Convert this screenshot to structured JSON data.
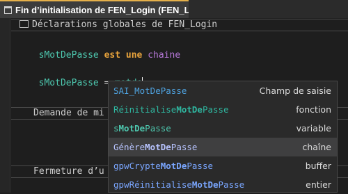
{
  "tab": {
    "title": "Fin d’initialisation de FEN_Login (FEN_Lo..."
  },
  "sections": {
    "declarations": "Déclarations globales de FEN_Login",
    "demande": "Demande de mi",
    "fermeture": "Fermeture d’u"
  },
  "code": {
    "line1": {
      "var": "sMotDePasse",
      "kw": "est une",
      "type": "chaine"
    },
    "line2": {
      "var": "sMotDePasse",
      "op": " = ",
      "typed": "motde"
    }
  },
  "autocomplete": {
    "items": [
      {
        "parts": [
          {
            "t": "SAI_",
            "m": false
          },
          {
            "t": "MotDePasse",
            "m": false
          }
        ],
        "type": "Champ de saisie",
        "color": "#4fa3e0",
        "selected": false
      },
      {
        "parts": [
          {
            "t": "Réinitialise",
            "m": false
          },
          {
            "t": "MotDe",
            "m": true
          },
          {
            "t": "Passe",
            "m": false
          }
        ],
        "type": "fonction",
        "color": "#2fb7a0",
        "selected": false
      },
      {
        "parts": [
          {
            "t": "s",
            "m": false
          },
          {
            "t": "MotDe",
            "m": true
          },
          {
            "t": "Passe",
            "m": false
          }
        ],
        "type": "variable",
        "color": "#4ec9b0",
        "selected": false
      },
      {
        "parts": [
          {
            "t": "Génère",
            "m": false
          },
          {
            "t": "MotDe",
            "m": true
          },
          {
            "t": "Passe",
            "m": false
          }
        ],
        "type": "chaîne",
        "color": "#b8c4ff",
        "selected": true
      },
      {
        "parts": [
          {
            "t": "gpwCrypte",
            "m": false
          },
          {
            "t": "MotDe",
            "m": true
          },
          {
            "t": "Passe",
            "m": false
          }
        ],
        "type": "buffer",
        "color": "#7aa6ff",
        "selected": false
      },
      {
        "parts": [
          {
            "t": "gpwRéinitialise",
            "m": false
          },
          {
            "t": "MotDe",
            "m": true
          },
          {
            "t": "Passe",
            "m": false
          }
        ],
        "type": "entier",
        "color": "#7aa6ff",
        "selected": false
      }
    ]
  }
}
